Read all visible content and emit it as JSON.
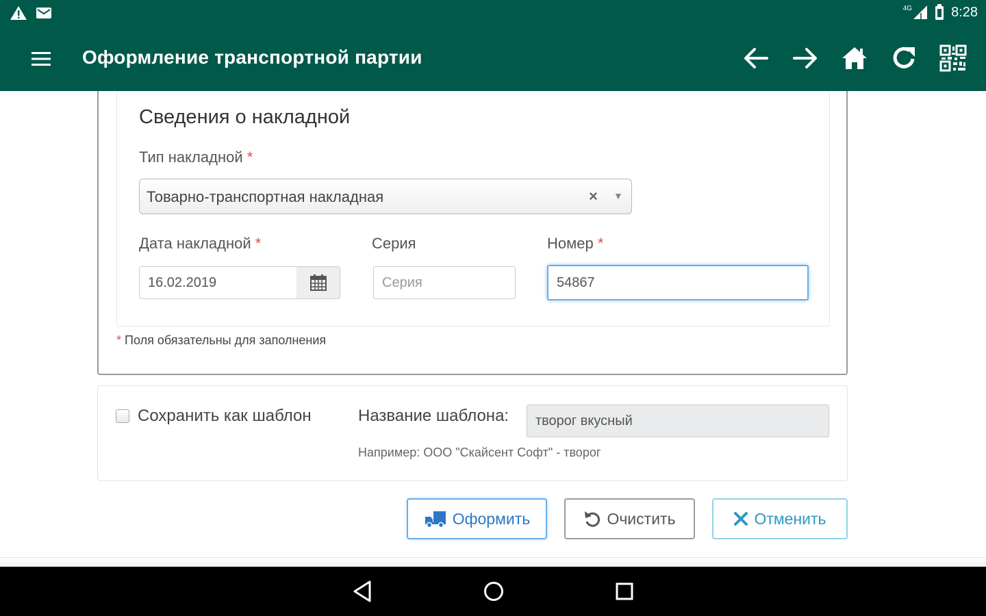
{
  "status_bar": {
    "time": "8:28",
    "network": "4G",
    "icons": [
      "warning-icon",
      "mail-icon",
      "signal-icon",
      "battery-icon"
    ]
  },
  "app_bar": {
    "title": "Оформление транспортной партии",
    "icons": [
      "menu-icon",
      "back-arrow-icon",
      "forward-arrow-icon",
      "home-icon",
      "refresh-icon",
      "qr-code-icon"
    ]
  },
  "invoice": {
    "section_title": "Сведения о накладной",
    "type_label": "Тип накладной",
    "type_value": "Товарно-транспортная накладная",
    "clear_symbol": "×",
    "dropdown_symbol": "▼",
    "date_label": "Дата накладной",
    "date_value": "16.02.2019",
    "series_label": "Серия",
    "series_placeholder": "Серия",
    "number_label": "Номер",
    "number_value": "54867",
    "required_mark": "*",
    "required_note": "Поля обязательны для заполнения"
  },
  "template": {
    "checkbox_label": "Сохранить как шаблон",
    "name_label": "Название шаблона:",
    "name_value": "творог вкусный",
    "help_text": "Например: ООО \"Скайсент Софт\" - творог"
  },
  "buttons": {
    "submit": "Оформить",
    "clear": "Очистить",
    "cancel": "Отменить"
  },
  "colors": {
    "app_bar": "#01594a",
    "primary": "#2b78c5",
    "required": "#d9534f",
    "cancel": "#2a9ac0"
  }
}
